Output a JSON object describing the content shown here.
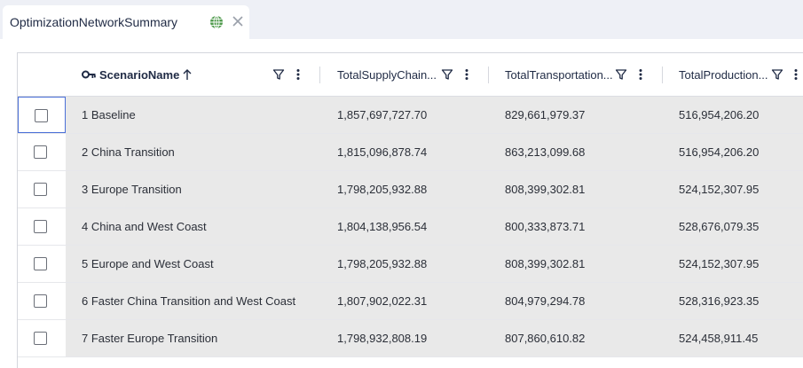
{
  "tab": {
    "title": "OptimizationNetworkSummary",
    "globe_icon": "globe-icon",
    "close_icon": "close-icon"
  },
  "grid": {
    "columns": [
      {
        "label": "ScenarioName",
        "key_icon": "key-icon",
        "sort": "ascending"
      },
      {
        "label": "TotalSupplyChain..."
      },
      {
        "label": "TotalTransportation..."
      },
      {
        "label": "TotalProduction..."
      }
    ],
    "rows": [
      {
        "name": "1 Baseline",
        "tsc": "1,857,697,727.70",
        "tt": "829,661,979.37",
        "tp": "516,954,206.20"
      },
      {
        "name": "2 China Transition",
        "tsc": "1,815,096,878.74",
        "tt": "863,213,099.68",
        "tp": "516,954,206.20"
      },
      {
        "name": "3 Europe Transition",
        "tsc": "1,798,205,932.88",
        "tt": "808,399,302.81",
        "tp": "524,152,307.95"
      },
      {
        "name": "4 China and West Coast",
        "tsc": "1,804,138,956.54",
        "tt": "800,333,873.71",
        "tp": "528,676,079.35"
      },
      {
        "name": "5 Europe and West Coast",
        "tsc": "1,798,205,932.88",
        "tt": "808,399,302.81",
        "tp": "524,152,307.95"
      },
      {
        "name": "6 Faster China Transition and West Coast",
        "tsc": "1,807,902,022.31",
        "tt": "804,979,294.78",
        "tp": "528,316,923.35"
      },
      {
        "name": "7 Faster Europe Transition",
        "tsc": "1,798,932,808.19",
        "tt": "807,860,610.82",
        "tp": "524,458,911.45"
      }
    ]
  },
  "colors": {
    "focus_border": "#4a6fd8",
    "row_fill": "#e9e9e9",
    "tab_text": "#1f2a44"
  }
}
